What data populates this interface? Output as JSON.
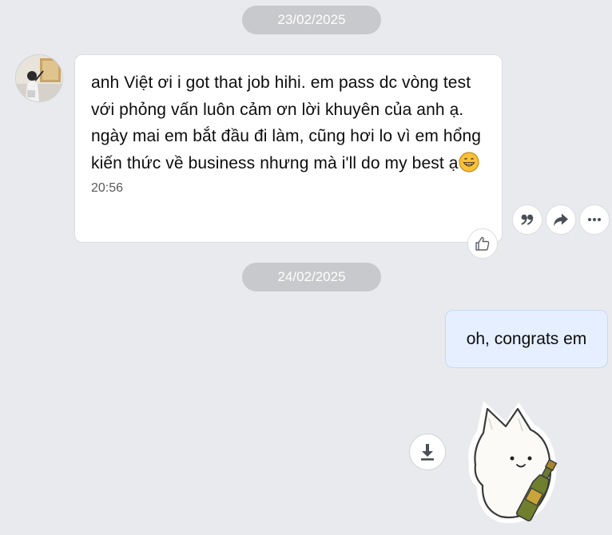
{
  "dates": [
    "23/02/2025",
    "24/02/2025"
  ],
  "incoming": {
    "text": "anh Việt ơi i got that job hihi. em pass dc vòng test với phỏng vấn luôn cảm ơn lời khuyên của anh ạ. ngày mai em bắt đầu đi làm, cũng hơi lo vì em hổng kiến thức về business nhưng mà i'll do my best ạ",
    "emoji": "grinning-face-emoji",
    "time": "20:56"
  },
  "actions": [
    "quote-icon",
    "share-icon",
    "more-icon"
  ],
  "reaction": "thumbs-up-icon",
  "outgoing": {
    "text": "oh, congrats em"
  },
  "sticker": {
    "download": "download-icon",
    "name": "cat-with-champagne-sticker"
  },
  "colors": {
    "background": "#e9eaed",
    "date_pill": "#c8c9cc",
    "incoming_bubble": "#ffffff",
    "outgoing_bubble": "#e5efff",
    "icon": "#4a4f57"
  }
}
